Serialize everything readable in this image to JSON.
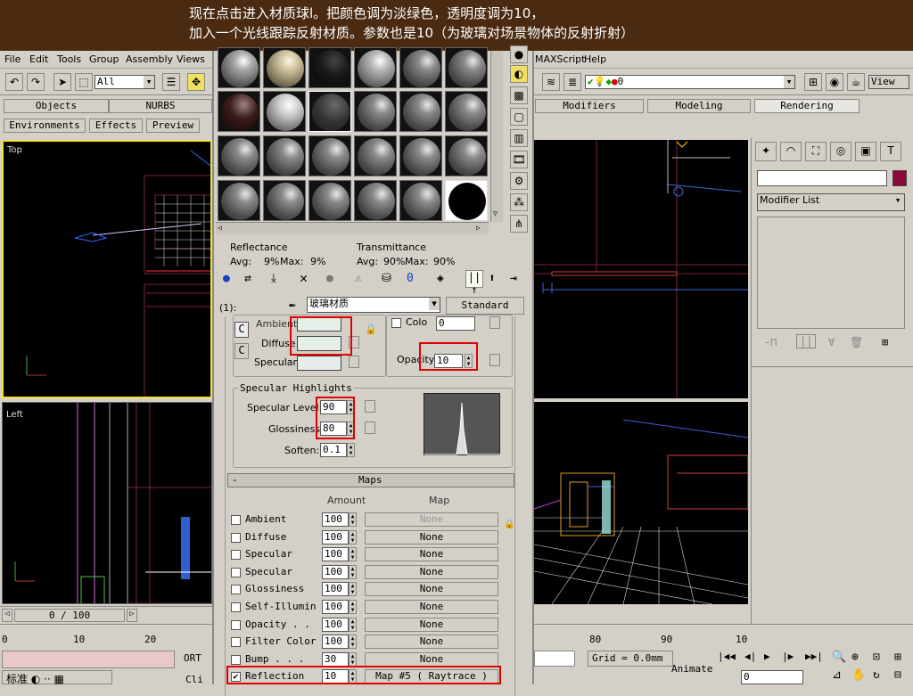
{
  "banner": {
    "line1": "现在点击进入材质球l。把颜色调为淡绿色，透明度调为10，",
    "line2": "加入一个光线跟踪反射材质。参数也是10（为玻璃对场景物体的反射折射）"
  },
  "menu": {
    "file": "File",
    "edit": "Edit",
    "tools": "Tools",
    "group": "Group",
    "assembly": "Assembly",
    "views": "Views",
    "maxscript": "MAXScript",
    "help": "Help"
  },
  "toolbar": {
    "selection_filter": "All",
    "layer_value": "0",
    "view_label": "View"
  },
  "left_tabs": {
    "objects": "Objects",
    "nurbs": "NURBS",
    "environments": "Environments",
    "effects": "Effects",
    "preview": "Preview"
  },
  "right_tabs": {
    "modifiers": "Modifiers",
    "modeling": "Modeling",
    "rendering": "Rendering"
  },
  "viewports": {
    "top": "Top",
    "left": "Left"
  },
  "timeline": {
    "frame": "0 / 100",
    "ticks_left": [
      "0",
      "10",
      "20"
    ],
    "ticks_right": [
      "80",
      "90",
      "10"
    ]
  },
  "material_editor": {
    "reflectance": {
      "title": "Reflectance",
      "avg_label": "Avg:",
      "avg": "9%",
      "max_label": "Max:",
      "max": "9%"
    },
    "transmittance": {
      "title": "Transmittance",
      "avg_label": "Avg:",
      "avg": "90%",
      "max_label": "Max:",
      "max": "90%"
    },
    "slot_label": "(1):",
    "material_name": "玻璃材质",
    "material_type": "Standard",
    "basic": {
      "ambient": "Ambient",
      "diffuse": "Diffuse",
      "specular": "Specular",
      "color_label": "Colo",
      "color_value": "0",
      "opacity_label": "Opacity",
      "opacity_value": "10"
    },
    "highlights": {
      "title": "Specular Highlights",
      "level_label": "Specular Level:",
      "level": "90",
      "gloss_label": "Glossiness:",
      "gloss": "80",
      "soften_label": "Soften:",
      "soften": "0.1"
    },
    "maps": {
      "title": "Maps",
      "collapse": "-",
      "col_amount": "Amount",
      "col_map": "Map",
      "rows": [
        {
          "name": "Ambient",
          "amount": "100",
          "map": "None",
          "checked": false
        },
        {
          "name": "Diffuse",
          "amount": "100",
          "map": "None",
          "checked": false
        },
        {
          "name": "Specular",
          "amount": "100",
          "map": "None",
          "checked": false
        },
        {
          "name": "Specular",
          "amount": "100",
          "map": "None",
          "checked": false
        },
        {
          "name": "Glossiness",
          "amount": "100",
          "map": "None",
          "checked": false
        },
        {
          "name": "Self-Illumin",
          "amount": "100",
          "map": "None",
          "checked": false
        },
        {
          "name": "Opacity . .",
          "amount": "100",
          "map": "None",
          "checked": false
        },
        {
          "name": "Filter Color",
          "amount": "100",
          "map": "None",
          "checked": false
        },
        {
          "name": "Bump  . . .",
          "amount": "30",
          "map": "None",
          "checked": false
        },
        {
          "name": "Reflection",
          "amount": "10",
          "map": "Map #5  ( Raytrace )",
          "checked": true
        }
      ]
    }
  },
  "command_panel": {
    "modifier_list": "Modifier List",
    "name_color": "#8b0a3a"
  },
  "status": {
    "lang": "标准",
    "ort": "ORT",
    "cli": "Cli",
    "grid": "Grid = 0.0mm",
    "animate": "Animate",
    "frame_field": "0"
  },
  "colors": {
    "banner_bg": "#4a2a10",
    "highlight_box": "#e00000",
    "diffuse_swatch": "#e4efe8",
    "viewport_bg": "#000000"
  }
}
